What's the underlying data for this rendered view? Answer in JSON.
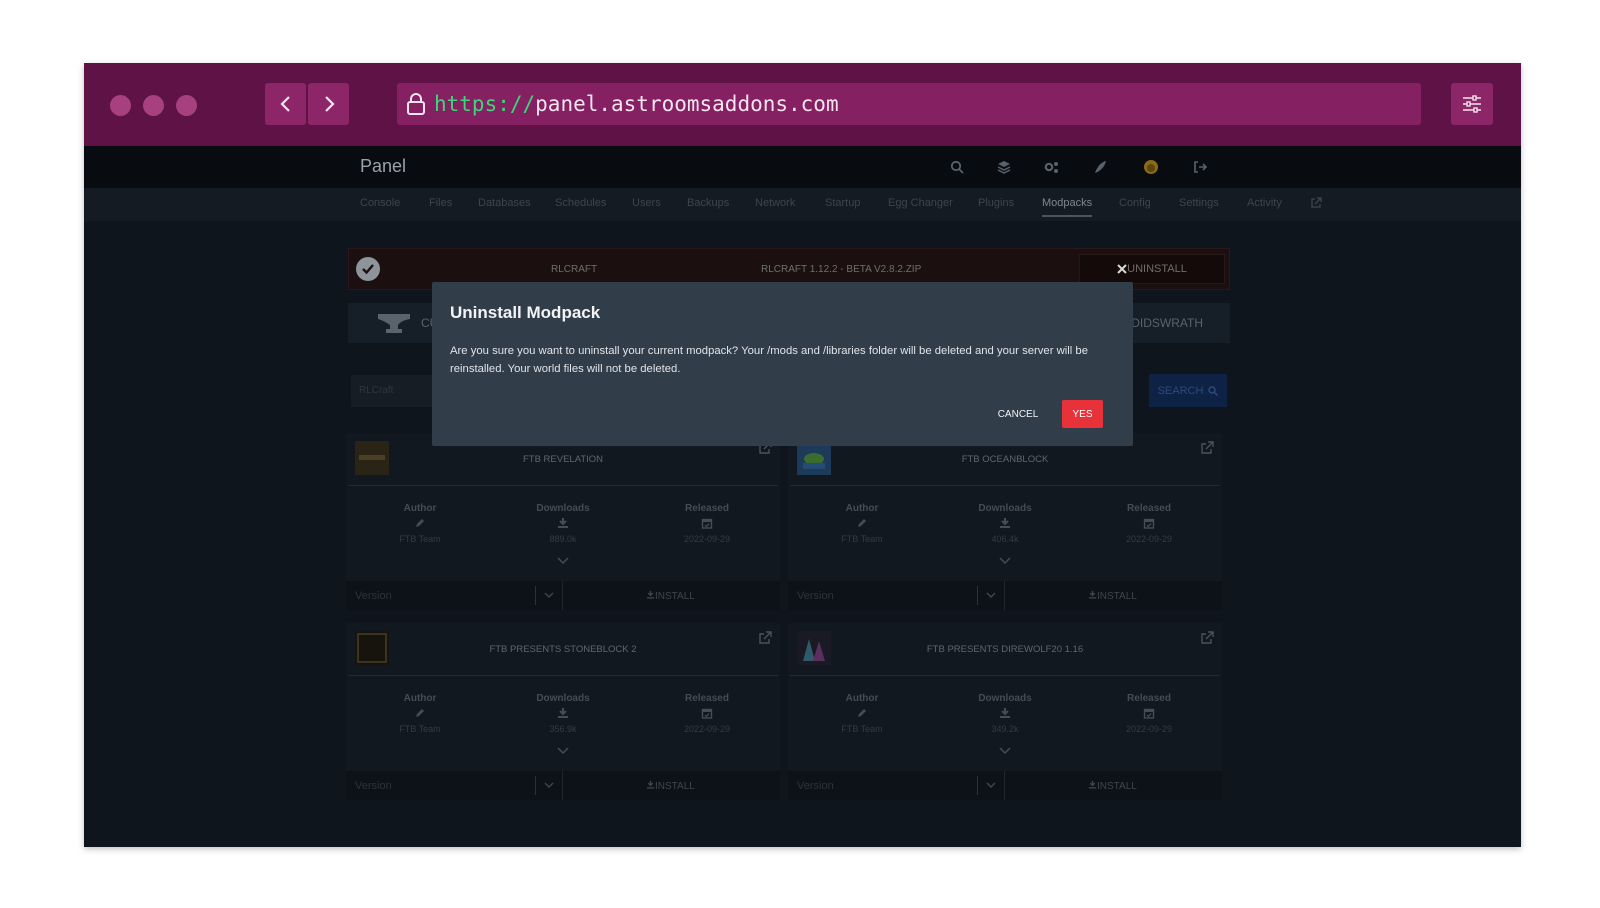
{
  "browser": {
    "url_protocol": "https://",
    "url_host": "panel.astroomsaddons.com"
  },
  "topnav": {
    "brand": "Panel"
  },
  "subnav": {
    "tabs": [
      "Console",
      "Files",
      "Databases",
      "Schedules",
      "Users",
      "Backups",
      "Network",
      "Startup",
      "Egg Changer",
      "Plugins",
      "Modpacks",
      "Config",
      "Settings",
      "Activity"
    ],
    "active_tab": "Modpacks"
  },
  "installed": {
    "name": "RLCRAFT",
    "file": "RLCRAFT 1.12.2 - BETA V2.8.2.ZIP",
    "uninstall_label": "UNINSTALL"
  },
  "categories": {
    "left_label": "CU",
    "right_label": "DIDSWRATH"
  },
  "search": {
    "placeholder": "RLCraft",
    "button_label": "SEARCH"
  },
  "stat_labels": {
    "author": "Author",
    "downloads": "Downloads",
    "released": "Released"
  },
  "cards": [
    {
      "title": "FTB REVELATION",
      "author": "FTB Team",
      "downloads": "889.0k",
      "released": "2022-09-29",
      "version_placeholder": "Version",
      "install_label": "INSTALL"
    },
    {
      "title": "FTB OCEANBLOCK",
      "author": "FTB Team",
      "downloads": "406.4k",
      "released": "2022-09-29",
      "version_placeholder": "Version",
      "install_label": "INSTALL"
    },
    {
      "title": "FTB PRESENTS STONEBLOCK 2",
      "author": "FTB Team",
      "downloads": "356.9k",
      "released": "2022-09-29",
      "version_placeholder": "Version",
      "install_label": "INSTALL"
    },
    {
      "title": "FTB PRESENTS DIREWOLF20 1.16",
      "author": "FTB Team",
      "downloads": "349.2k",
      "released": "2022-09-29",
      "version_placeholder": "Version",
      "install_label": "INSTALL"
    }
  ],
  "modal": {
    "title": "Uninstall Modpack",
    "body": "Are you sure you want to uninstall your current modpack? Your /mods and /libraries folder will be deleted and your server will be reinstalled. Your world files will not be deleted.",
    "cancel_label": "CANCEL",
    "confirm_label": "YES"
  },
  "colors": {
    "chrome": "#5e1246",
    "url_protocol": "#3ed67a",
    "modal_bg": "#323d4a",
    "confirm": "#e8323a"
  }
}
